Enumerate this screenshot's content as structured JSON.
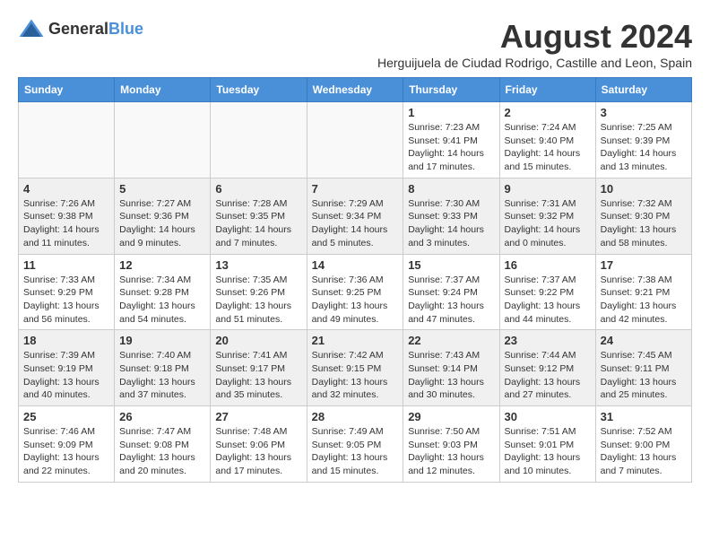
{
  "logo": {
    "general": "General",
    "blue": "Blue"
  },
  "title": "August 2024",
  "subtitle": "Herguijuela de Ciudad Rodrigo, Castille and Leon, Spain",
  "headers": [
    "Sunday",
    "Monday",
    "Tuesday",
    "Wednesday",
    "Thursday",
    "Friday",
    "Saturday"
  ],
  "weeks": [
    [
      {
        "day": "",
        "info": ""
      },
      {
        "day": "",
        "info": ""
      },
      {
        "day": "",
        "info": ""
      },
      {
        "day": "",
        "info": ""
      },
      {
        "day": "1",
        "info": "Sunrise: 7:23 AM\nSunset: 9:41 PM\nDaylight: 14 hours\nand 17 minutes."
      },
      {
        "day": "2",
        "info": "Sunrise: 7:24 AM\nSunset: 9:40 PM\nDaylight: 14 hours\nand 15 minutes."
      },
      {
        "day": "3",
        "info": "Sunrise: 7:25 AM\nSunset: 9:39 PM\nDaylight: 14 hours\nand 13 minutes."
      }
    ],
    [
      {
        "day": "4",
        "info": "Sunrise: 7:26 AM\nSunset: 9:38 PM\nDaylight: 14 hours\nand 11 minutes."
      },
      {
        "day": "5",
        "info": "Sunrise: 7:27 AM\nSunset: 9:36 PM\nDaylight: 14 hours\nand 9 minutes."
      },
      {
        "day": "6",
        "info": "Sunrise: 7:28 AM\nSunset: 9:35 PM\nDaylight: 14 hours\nand 7 minutes."
      },
      {
        "day": "7",
        "info": "Sunrise: 7:29 AM\nSunset: 9:34 PM\nDaylight: 14 hours\nand 5 minutes."
      },
      {
        "day": "8",
        "info": "Sunrise: 7:30 AM\nSunset: 9:33 PM\nDaylight: 14 hours\nand 3 minutes."
      },
      {
        "day": "9",
        "info": "Sunrise: 7:31 AM\nSunset: 9:32 PM\nDaylight: 14 hours\nand 0 minutes."
      },
      {
        "day": "10",
        "info": "Sunrise: 7:32 AM\nSunset: 9:30 PM\nDaylight: 13 hours\nand 58 minutes."
      }
    ],
    [
      {
        "day": "11",
        "info": "Sunrise: 7:33 AM\nSunset: 9:29 PM\nDaylight: 13 hours\nand 56 minutes."
      },
      {
        "day": "12",
        "info": "Sunrise: 7:34 AM\nSunset: 9:28 PM\nDaylight: 13 hours\nand 54 minutes."
      },
      {
        "day": "13",
        "info": "Sunrise: 7:35 AM\nSunset: 9:26 PM\nDaylight: 13 hours\nand 51 minutes."
      },
      {
        "day": "14",
        "info": "Sunrise: 7:36 AM\nSunset: 9:25 PM\nDaylight: 13 hours\nand 49 minutes."
      },
      {
        "day": "15",
        "info": "Sunrise: 7:37 AM\nSunset: 9:24 PM\nDaylight: 13 hours\nand 47 minutes."
      },
      {
        "day": "16",
        "info": "Sunrise: 7:37 AM\nSunset: 9:22 PM\nDaylight: 13 hours\nand 44 minutes."
      },
      {
        "day": "17",
        "info": "Sunrise: 7:38 AM\nSunset: 9:21 PM\nDaylight: 13 hours\nand 42 minutes."
      }
    ],
    [
      {
        "day": "18",
        "info": "Sunrise: 7:39 AM\nSunset: 9:19 PM\nDaylight: 13 hours\nand 40 minutes."
      },
      {
        "day": "19",
        "info": "Sunrise: 7:40 AM\nSunset: 9:18 PM\nDaylight: 13 hours\nand 37 minutes."
      },
      {
        "day": "20",
        "info": "Sunrise: 7:41 AM\nSunset: 9:17 PM\nDaylight: 13 hours\nand 35 minutes."
      },
      {
        "day": "21",
        "info": "Sunrise: 7:42 AM\nSunset: 9:15 PM\nDaylight: 13 hours\nand 32 minutes."
      },
      {
        "day": "22",
        "info": "Sunrise: 7:43 AM\nSunset: 9:14 PM\nDaylight: 13 hours\nand 30 minutes."
      },
      {
        "day": "23",
        "info": "Sunrise: 7:44 AM\nSunset: 9:12 PM\nDaylight: 13 hours\nand 27 minutes."
      },
      {
        "day": "24",
        "info": "Sunrise: 7:45 AM\nSunset: 9:11 PM\nDaylight: 13 hours\nand 25 minutes."
      }
    ],
    [
      {
        "day": "25",
        "info": "Sunrise: 7:46 AM\nSunset: 9:09 PM\nDaylight: 13 hours\nand 22 minutes."
      },
      {
        "day": "26",
        "info": "Sunrise: 7:47 AM\nSunset: 9:08 PM\nDaylight: 13 hours\nand 20 minutes."
      },
      {
        "day": "27",
        "info": "Sunrise: 7:48 AM\nSunset: 9:06 PM\nDaylight: 13 hours\nand 17 minutes."
      },
      {
        "day": "28",
        "info": "Sunrise: 7:49 AM\nSunset: 9:05 PM\nDaylight: 13 hours\nand 15 minutes."
      },
      {
        "day": "29",
        "info": "Sunrise: 7:50 AM\nSunset: 9:03 PM\nDaylight: 13 hours\nand 12 minutes."
      },
      {
        "day": "30",
        "info": "Sunrise: 7:51 AM\nSunset: 9:01 PM\nDaylight: 13 hours\nand 10 minutes."
      },
      {
        "day": "31",
        "info": "Sunrise: 7:52 AM\nSunset: 9:00 PM\nDaylight: 13 hours\nand 7 minutes."
      }
    ]
  ]
}
